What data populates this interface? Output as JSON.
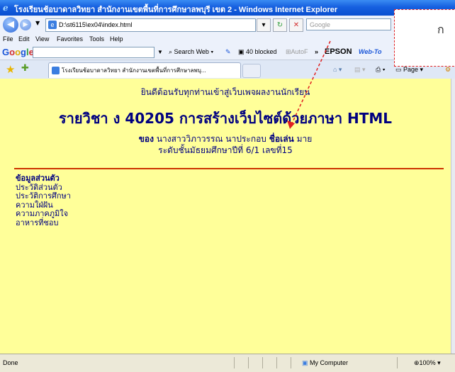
{
  "window": {
    "title": "โรงเรียนช้อบาดาลวิทยา สำนักงานเขตพื้นที่การศึกษาลพบุรี เขต 2 - Windows Internet Explorer"
  },
  "addressbar": {
    "back_icon": "back-arrow-icon",
    "forward_icon": "forward-arrow-icon",
    "url": "D:\\st6115\\ex04\\index.html",
    "search_placeholder": "Google"
  },
  "menubar": {
    "items": [
      "File",
      "Edit",
      "View",
      "Favorites",
      "Tools",
      "Help"
    ]
  },
  "google_toolbar": {
    "logo": "Google",
    "search_web": "Search Web",
    "blocked": "40 blocked",
    "autofill": "AutoF",
    "more": "»",
    "epson": "EPSON",
    "web_to": "Web-To"
  },
  "tabs": {
    "active_tab": "โรงเรียนช้อบาดาลวิทยา สำนักงานเขตพื้นที่การศึกษาลพบุ...",
    "page_btn": "Page"
  },
  "page": {
    "welcome": "ยินดีต้อนรับทุกท่านเข้าสู่เว็บเพจผลงานนักเรียน",
    "course": "รายวิชา ง 40205 การสร้างเว็บไซต์ด้วยภาษา HTML",
    "by_label": "ของ",
    "student_name": "นางสาววิภาวรรณ นาประกอบ",
    "nickname_label": "ชื่อเล่น",
    "nickname": "มาย",
    "level_label": "ระดับชั้นมัธยมศึกษาปีที่ 6/1 เลขที่15",
    "menu_heading": "ข้อมูลส่วนตัว",
    "menu_items": [
      "ประวัติส่วนตัว",
      "ประวัติการศึกษา",
      "ความใฝ่ฝัน",
      "ความภาคภูมิใจ",
      "อาหารที่ชอบ"
    ]
  },
  "statusbar": {
    "status": "Done",
    "zone": "My Computer",
    "zoom": "100%"
  },
  "callout": {
    "text": "ก"
  },
  "colors": {
    "page_bg": "#ffff99",
    "text_navy": "#000080",
    "rule": "#cc3300",
    "callout_border": "#e02020"
  }
}
